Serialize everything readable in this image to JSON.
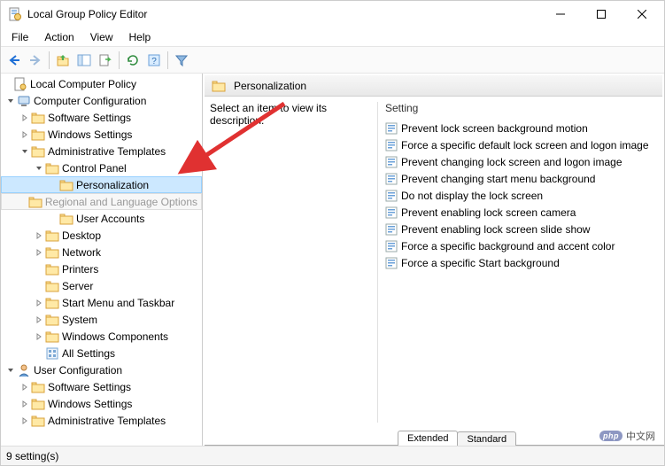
{
  "window": {
    "title": "Local Group Policy Editor"
  },
  "menubar": [
    "File",
    "Action",
    "View",
    "Help"
  ],
  "tree": {
    "root": "Local Computer Policy",
    "computer_cfg": "Computer Configuration",
    "cc_children": {
      "software": "Software Settings",
      "windows": "Windows Settings",
      "admin": "Administrative Templates",
      "admin_children": {
        "control_panel": "Control Panel",
        "cp_children": {
          "personalization": "Personalization",
          "regional": "Regional and Language Options",
          "user_accounts": "User Accounts"
        },
        "desktop": "Desktop",
        "network": "Network",
        "printers": "Printers",
        "server": "Server",
        "start_menu": "Start Menu and Taskbar",
        "system": "System",
        "win_components": "Windows Components",
        "all_settings": "All Settings"
      }
    },
    "user_cfg": "User Configuration",
    "uc_children": {
      "software": "Software Settings",
      "windows": "Windows Settings",
      "admin": "Administrative Templates"
    }
  },
  "content": {
    "header": "Personalization",
    "description": "Select an item to view its description.",
    "column_header": "Setting",
    "settings": [
      "Prevent lock screen background motion",
      "Force a specific default lock screen and logon image",
      "Prevent changing lock screen and logon image",
      "Prevent changing start menu background",
      "Do not display the lock screen",
      "Prevent enabling lock screen camera",
      "Prevent enabling lock screen slide show",
      "Force a specific background and accent color",
      "Force a specific Start background"
    ]
  },
  "tabs": {
    "extended": "Extended",
    "standard": "Standard"
  },
  "status": "9 setting(s)",
  "watermark": "中文网"
}
